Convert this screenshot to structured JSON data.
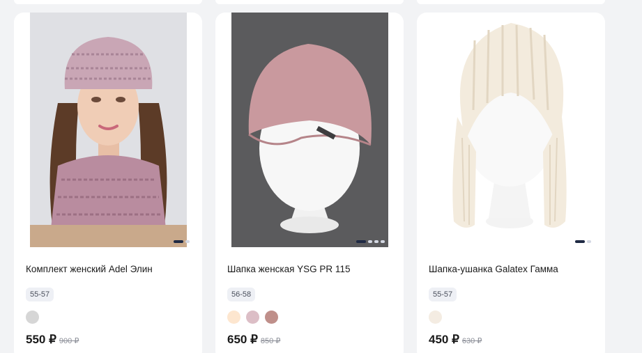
{
  "products": [
    {
      "title": "Комплект женский Adel Элин",
      "size": "55-57",
      "price": "550 ₽",
      "old_price": "900 ₽",
      "colors": [
        "#d6d6d6"
      ],
      "image_dots": 2,
      "active_dot": 0
    },
    {
      "title": "Шапка женская YSG PR 115",
      "size": "56-58",
      "price": "650 ₽",
      "old_price": "850 ₽",
      "colors": [
        "#fde6cf",
        "#dcbec6",
        "#bf8f8a"
      ],
      "image_dots": 4,
      "active_dot": 0
    },
    {
      "title": "Шапка-ушанка Galatex Гамма",
      "size": "55-57",
      "price": "450 ₽",
      "old_price": "630 ₽",
      "colors": [
        "#f4ece2"
      ],
      "image_dots": 2,
      "active_dot": 0
    }
  ]
}
